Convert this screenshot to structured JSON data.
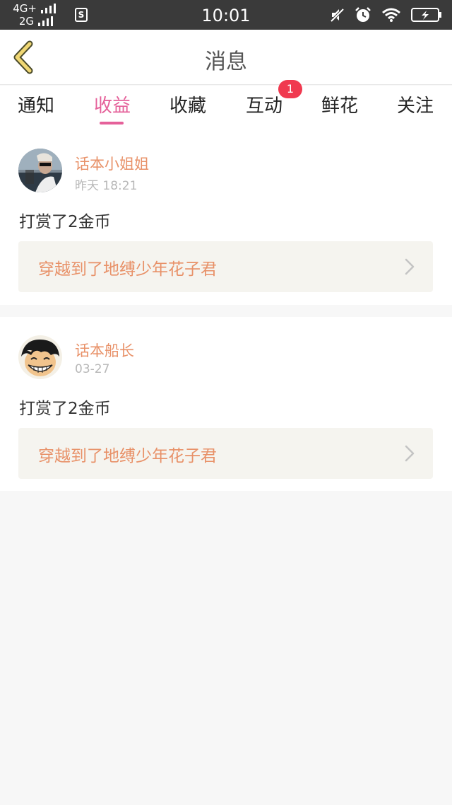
{
  "status_bar": {
    "network_top": "4G+",
    "network_bottom": "2G",
    "s_icon": "S",
    "time": "10:01",
    "icons": [
      "mute-icon",
      "alarm-icon",
      "wifi-icon",
      "battery-charging-icon"
    ]
  },
  "header": {
    "title": "消息",
    "back_icon": "chevron-left-icon"
  },
  "tabs": [
    {
      "label": "通知",
      "active": false
    },
    {
      "label": "收益",
      "active": true
    },
    {
      "label": "收藏",
      "active": false
    },
    {
      "label": "互动",
      "active": false,
      "badge": "1"
    },
    {
      "label": "鲜花",
      "active": false
    },
    {
      "label": "关注",
      "active": false
    }
  ],
  "messages": [
    {
      "user": "话本小姐姐",
      "time": "昨天 18:21",
      "text": "打赏了2金币",
      "book": "穿越到了地缚少年花子君"
    },
    {
      "user": "话本船长",
      "time": "03-27",
      "text": "打赏了2金币",
      "book": "穿越到了地缚少年花子君"
    }
  ],
  "colors": {
    "accent": "#e5619a",
    "username": "#e89168",
    "badge": "#f0394f",
    "book_bg": "#f5f4ef"
  }
}
